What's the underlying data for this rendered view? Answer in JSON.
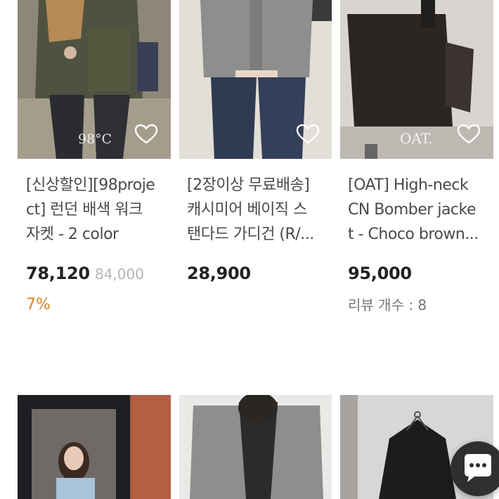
{
  "products": [
    {
      "title_lines": [
        "[신상할인][98proje",
        "ct] 런던 배색 워크",
        "자켓 - 2 color"
      ],
      "price": "78,120",
      "original_price": "84,000",
      "discount": "7%",
      "brand_mark": "98°C"
    },
    {
      "title_lines": [
        "[2장이상 무료배송]",
        "캐시미어 베이직 스",
        "탠다드 가디건 (R/..."
      ],
      "price": "28,900"
    },
    {
      "title_lines": [
        "[OAT] High-neck",
        "CN Bomber jacke",
        "t - Choco brown..."
      ],
      "price": "95,000",
      "review": "리뷰 개수 : 8",
      "brand_mark": "OAT."
    }
  ],
  "icons": {
    "wishlist": "heart-outline-icon",
    "chat": "chat-bubble-icon"
  },
  "colors": {
    "discount": "#d9822b",
    "original_price": "#b5b5b5",
    "chat_button": "#2f2f2f"
  }
}
